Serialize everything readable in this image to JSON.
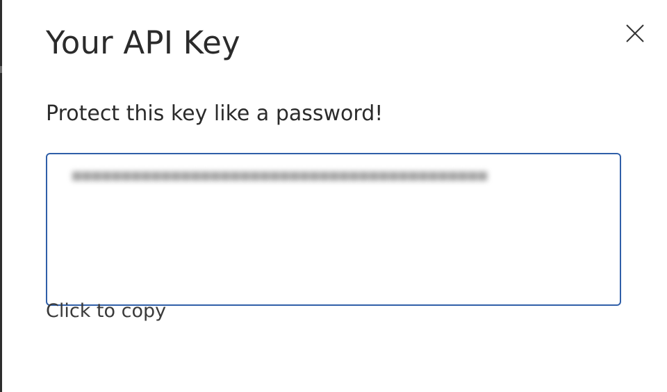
{
  "dialog": {
    "title": "Your API Key",
    "subtitle": "Protect this key like a password!",
    "close_icon": "close-icon",
    "copy_hint": "Click to copy"
  },
  "colors": {
    "text": "#2b2b2b",
    "key_box_border": "#2f5fa8",
    "background": "#ffffff"
  }
}
